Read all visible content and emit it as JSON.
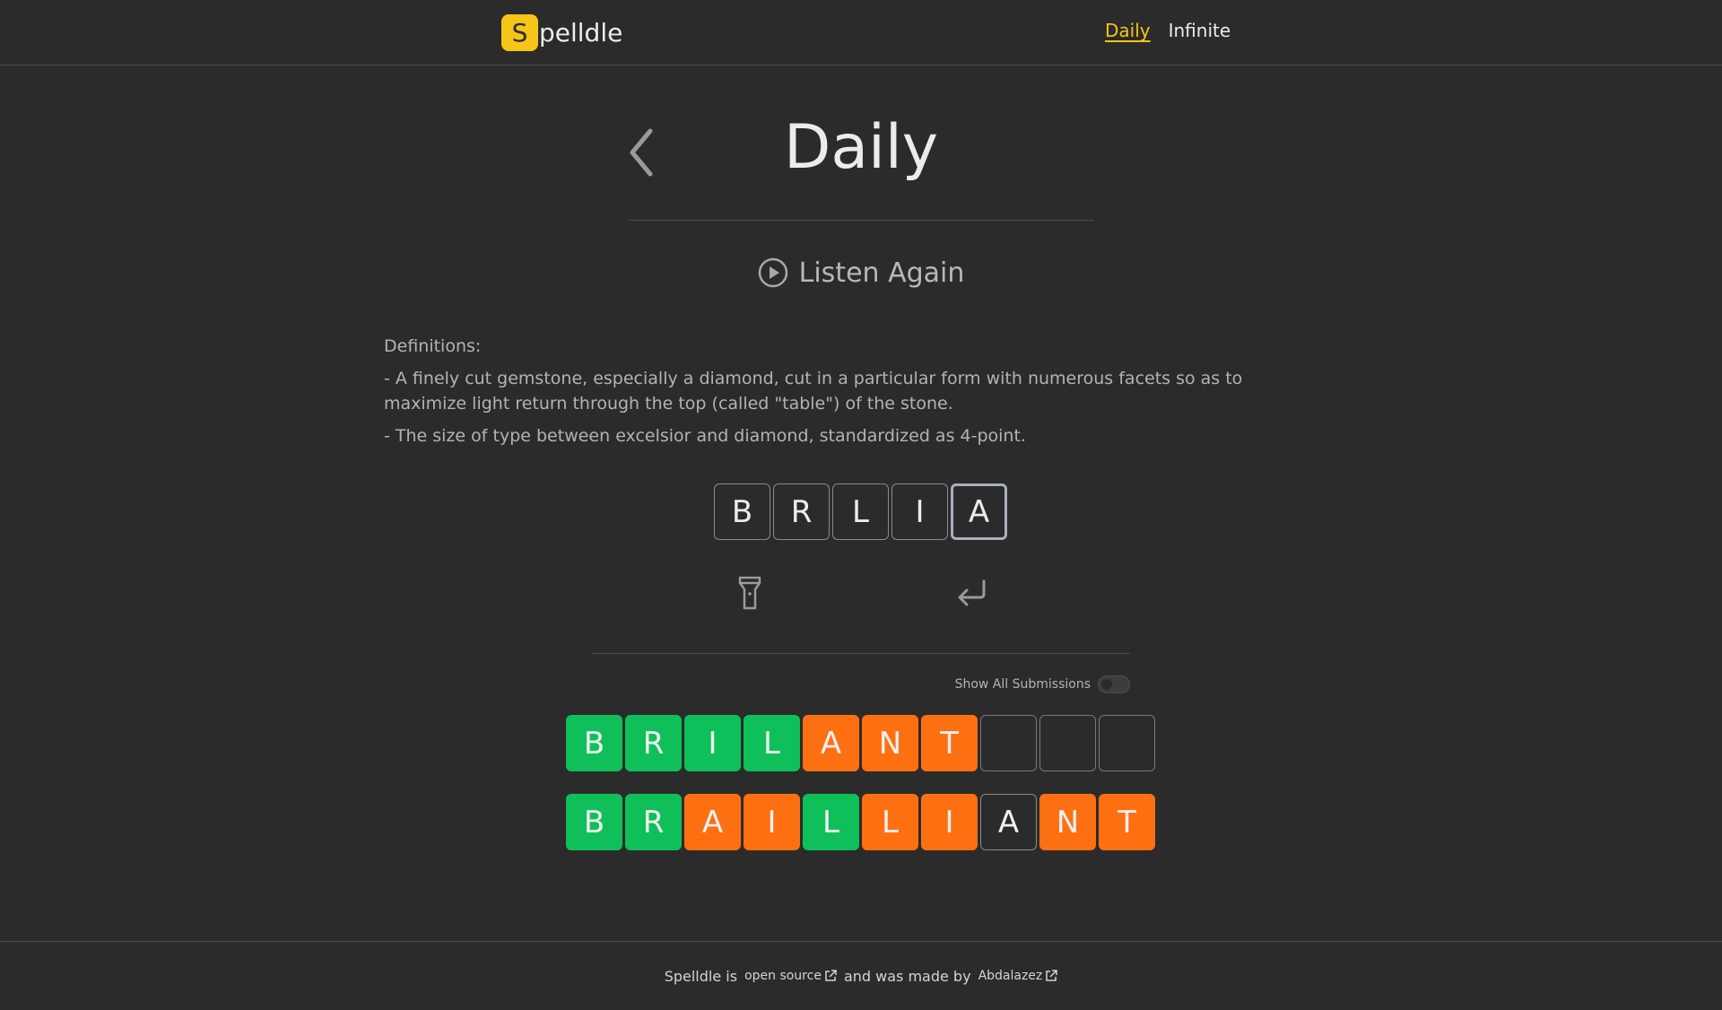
{
  "header": {
    "logo_letter": "S",
    "logo_rest": "pelldle",
    "nav": [
      {
        "label": "Daily",
        "active": true
      },
      {
        "label": "Infinite",
        "active": false
      }
    ]
  },
  "page": {
    "title": "Daily",
    "listen_label": "Listen Again"
  },
  "definitions": {
    "heading": "Definitions:",
    "items": [
      "- A finely cut gemstone, especially a diamond, cut in a particular form with numerous facets so as to maximize light return through the top (called \"table\") of the stone.",
      "- The size of type between excelsior and diamond, standardized as 4-point."
    ]
  },
  "input": {
    "letters": [
      "B",
      "R",
      "L",
      "I",
      "A"
    ],
    "focused_index": 4
  },
  "submissions": {
    "toggle_label": "Show All Submissions",
    "toggle_on": false,
    "rows": [
      [
        {
          "letter": "B",
          "state": "correct"
        },
        {
          "letter": "R",
          "state": "correct"
        },
        {
          "letter": "I",
          "state": "correct"
        },
        {
          "letter": "L",
          "state": "correct"
        },
        {
          "letter": "A",
          "state": "present"
        },
        {
          "letter": "N",
          "state": "present"
        },
        {
          "letter": "T",
          "state": "present"
        },
        {
          "letter": "",
          "state": "empty"
        },
        {
          "letter": "",
          "state": "empty"
        },
        {
          "letter": "",
          "state": "empty"
        }
      ],
      [
        {
          "letter": "B",
          "state": "correct"
        },
        {
          "letter": "R",
          "state": "correct"
        },
        {
          "letter": "A",
          "state": "present"
        },
        {
          "letter": "I",
          "state": "present"
        },
        {
          "letter": "L",
          "state": "correct"
        },
        {
          "letter": "L",
          "state": "present"
        },
        {
          "letter": "I",
          "state": "present"
        },
        {
          "letter": "A",
          "state": "absent"
        },
        {
          "letter": "N",
          "state": "present"
        },
        {
          "letter": "T",
          "state": "present"
        }
      ]
    ]
  },
  "footer": {
    "prefix": "Spelldle is",
    "link1": "open source",
    "middle": "and was made by",
    "link2": "Abdalazez"
  },
  "colors": {
    "accent": "#f5c518",
    "correct": "#0fc05a",
    "present": "#fd7012",
    "background": "#2b2b2b"
  },
  "icons": {
    "back": "chevron-left-icon",
    "listen": "play-circle-icon",
    "hint": "flashlight-icon",
    "enter": "enter-return-icon",
    "external": "external-link-icon"
  }
}
